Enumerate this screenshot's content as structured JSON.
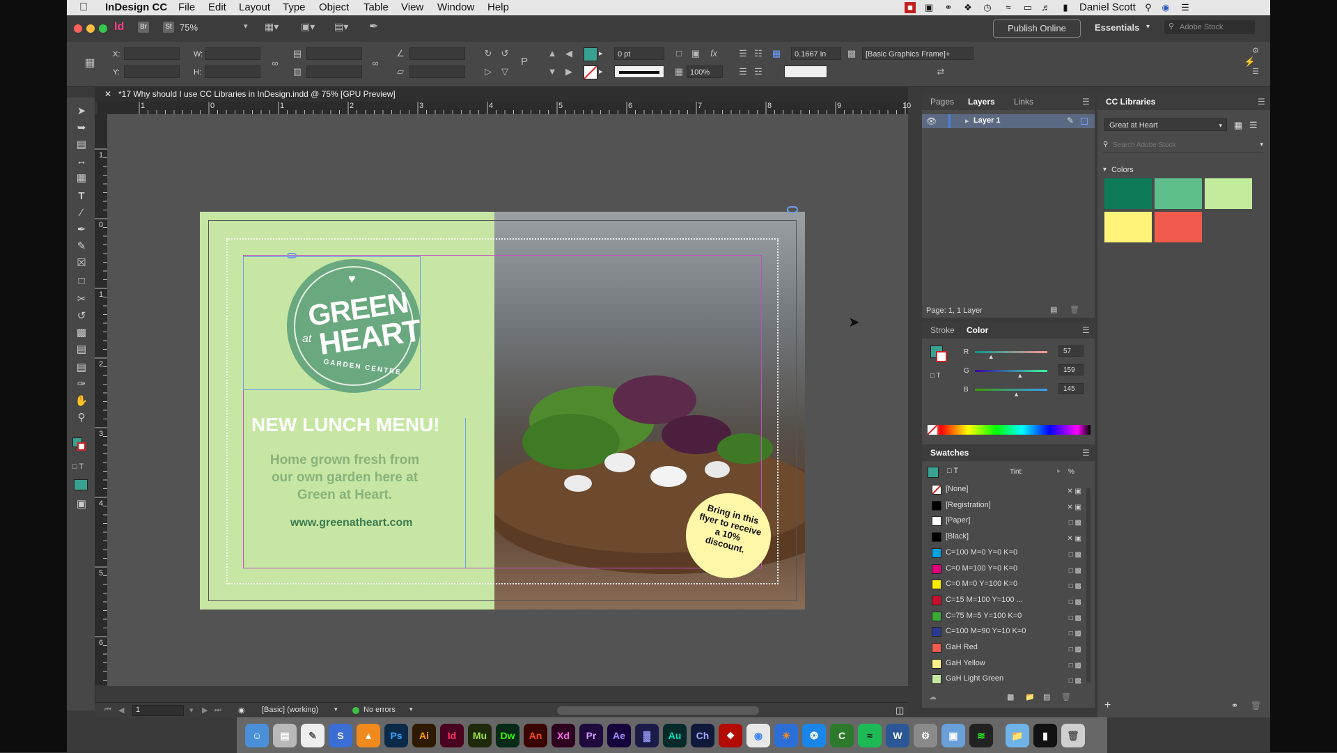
{
  "menubar": {
    "app_name": "InDesign CC",
    "menus": [
      "File",
      "Edit",
      "Layout",
      "Type",
      "Object",
      "Table",
      "View",
      "Window",
      "Help"
    ],
    "user": "Daniel Scott"
  },
  "appbar": {
    "zoom": "75%",
    "publish_online": "Publish Online",
    "workspace": "Essentials",
    "search_placeholder": "Adobe Stock"
  },
  "control": {
    "x_label": "X:",
    "y_label": "Y:",
    "w_label": "W:",
    "h_label": "H:",
    "stroke_weight": "0 pt",
    "scale": "100%",
    "offset": "0.1667 in",
    "object_style": "[Basic Graphics Frame]+"
  },
  "document": {
    "tab_title": "*17 Why should I use CC Libraries in InDesign.indd @ 75% [GPU Preview]",
    "h_ruler": [
      "1",
      "0",
      "1",
      "2",
      "3",
      "4",
      "5",
      "6",
      "7",
      "8",
      "9",
      "10"
    ],
    "v_ruler": [
      "1",
      "0",
      "1",
      "2",
      "3",
      "4",
      "5",
      "6"
    ]
  },
  "flyer": {
    "logo_line1": "GREEN",
    "logo_at": "at",
    "logo_line2": "HEART",
    "logo_sub": "GARDEN CENTRE",
    "headline": "NEW LUNCH MENU!",
    "body": "Home grown fresh from our own garden here at Green at Heart.",
    "url": "www.greenatheart.com",
    "badge": "Bring in this flyer to receive a 10% discount."
  },
  "statusbar": {
    "page": "1",
    "preflight_profile": "[Basic] (working)",
    "errors": "No errors"
  },
  "layers_panel": {
    "tabs": [
      "Pages",
      "Layers",
      "Links"
    ],
    "layer_name": "Layer 1",
    "footer": "Page: 1, 1 Layer"
  },
  "color_panel": {
    "tabs": [
      "Stroke",
      "Color"
    ],
    "channels": [
      {
        "label": "R",
        "value": "57",
        "level": 0.22
      },
      {
        "label": "G",
        "value": "159",
        "level": 0.62
      },
      {
        "label": "B",
        "value": "145",
        "level": 0.57
      }
    ]
  },
  "swatches_panel": {
    "title": "Swatches",
    "tint_label": "Tint:",
    "tint_unit": "%",
    "items": [
      {
        "name": "[None]",
        "color": "#ffffff"
      },
      {
        "name": "[Registration]",
        "color": "#000000"
      },
      {
        "name": "[Paper]",
        "color": "#ffffff"
      },
      {
        "name": "[Black]",
        "color": "#000000"
      },
      {
        "name": "C=100 M=0 Y=0 K=0",
        "color": "#00a2e0"
      },
      {
        "name": "C=0 M=100 Y=0 K=0",
        "color": "#e6007e"
      },
      {
        "name": "C=0 M=0 Y=100 K=0",
        "color": "#ffed00"
      },
      {
        "name": "C=15 M=100 Y=100 ...",
        "color": "#c8102e"
      },
      {
        "name": "C=75 M=5 Y=100 K=0",
        "color": "#3aa935"
      },
      {
        "name": "C=100 M=90 Y=10 K=0",
        "color": "#2b3990"
      },
      {
        "name": "GaH Red",
        "color": "#f05c50"
      },
      {
        "name": "GaH Yellow",
        "color": "#fff38a"
      },
      {
        "name": "GaH Light Green",
        "color": "#c7e6a4"
      }
    ]
  },
  "cc_libraries": {
    "title": "CC Libraries",
    "library": "Great at Heart",
    "search_placeholder": "Search Adobe Stock",
    "section": "Colors",
    "colors": [
      "#0f7a57",
      "#5ebf8c",
      "#c2ec9c",
      "#fff479",
      "#f25a4d"
    ]
  },
  "dock": {
    "apps": [
      "Ps",
      "Ai",
      "Id",
      "Mu",
      "Dw",
      "An",
      "Xd",
      "Pr",
      "Ae",
      "Au",
      "Ch"
    ]
  },
  "colors": {
    "flyer_green": "#c7e6a4",
    "logo_green": "#6aa87f",
    "badge_yellow": "#fff7a8",
    "frame_blue": "#6f9ee8",
    "frame_magenta": "#c04ec0"
  }
}
